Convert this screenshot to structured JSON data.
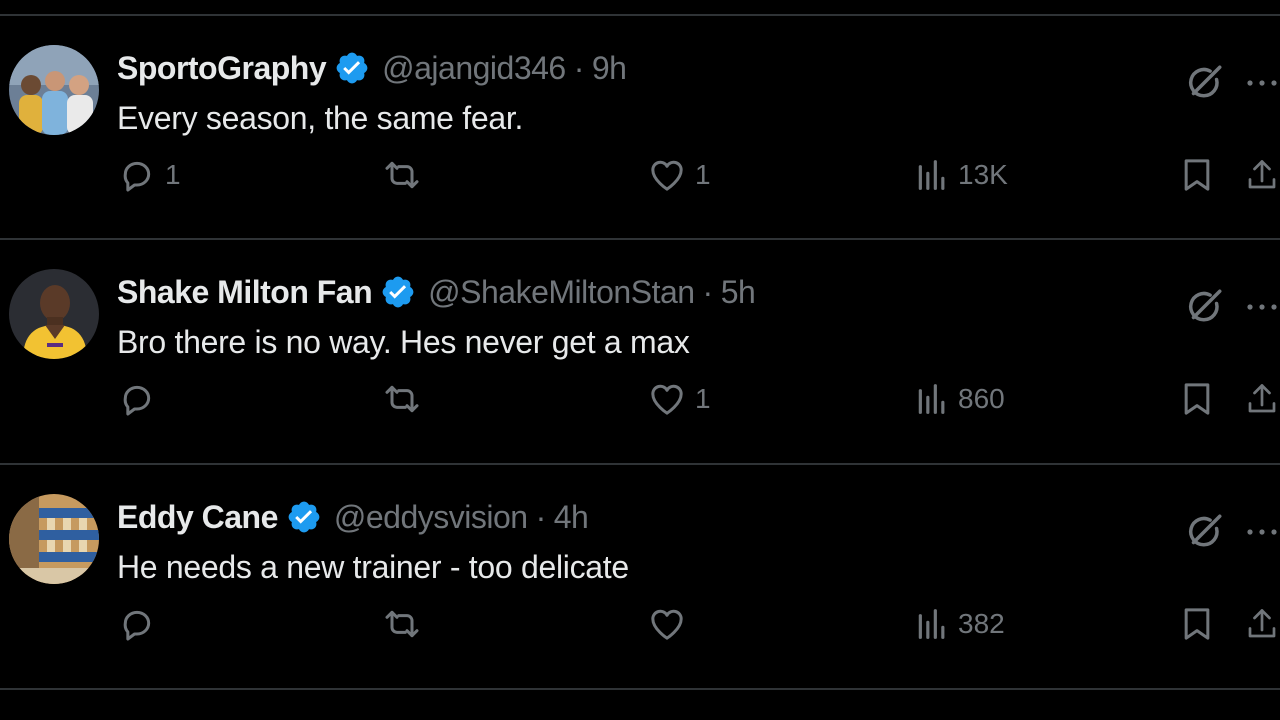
{
  "colors": {
    "background": "#000000",
    "text_primary": "#e7e9ea",
    "text_secondary": "#71767b",
    "verified_badge": "#1d9bf0",
    "divider": "#2f3336"
  },
  "tweets": [
    {
      "display_name": "SportoGraphy",
      "handle": "@ajangid346",
      "separator": "·",
      "time": "9h",
      "text": "Every season, the same fear.",
      "reply_count": "1",
      "retweet_count": "",
      "like_count": "1",
      "view_count": "13K",
      "icons": [
        "verified-badge-icon",
        "grok-icon",
        "more-icon",
        "reply-icon",
        "retweet-icon",
        "like-icon",
        "views-icon",
        "bookmark-icon",
        "share-icon"
      ]
    },
    {
      "display_name": "Shake Milton Fan",
      "handle": "@ShakeMiltonStan",
      "separator": "·",
      "time": "5h",
      "text": "Bro there is no way. Hes never get a max",
      "reply_count": "",
      "retweet_count": "",
      "like_count": "1",
      "view_count": "860",
      "icons": [
        "verified-badge-icon",
        "grok-icon",
        "more-icon",
        "reply-icon",
        "retweet-icon",
        "like-icon",
        "views-icon",
        "bookmark-icon",
        "share-icon"
      ]
    },
    {
      "display_name": "Eddy Cane",
      "handle": "@eddysvision",
      "separator": "·",
      "time": "4h",
      "text": "He needs a new trainer - too delicate",
      "reply_count": "",
      "retweet_count": "",
      "like_count": "",
      "view_count": "382",
      "icons": [
        "verified-badge-icon",
        "grok-icon",
        "more-icon",
        "reply-icon",
        "retweet-icon",
        "like-icon",
        "views-icon",
        "bookmark-icon",
        "share-icon"
      ]
    }
  ]
}
